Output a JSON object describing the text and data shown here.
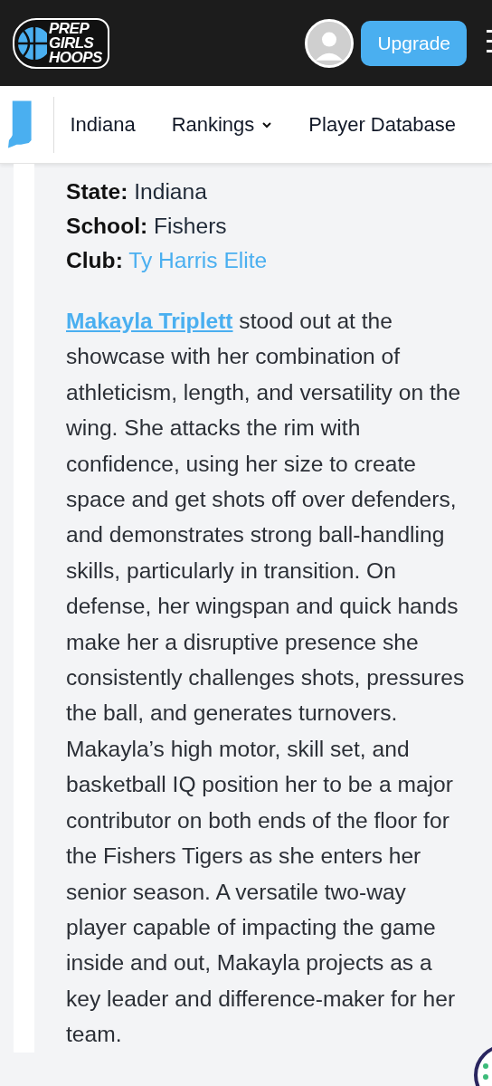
{
  "header": {
    "logo": {
      "lines": [
        "PREP",
        "GIRLS",
        "HOOPS"
      ]
    },
    "upgrade_button": "Upgrade"
  },
  "nav": {
    "items": [
      {
        "label": "Indiana",
        "kind": "link"
      },
      {
        "label": "Rankings",
        "kind": "dropdown"
      },
      {
        "label": "Player Database",
        "kind": "link"
      }
    ]
  },
  "details": [
    {
      "label": "State:",
      "value": "Indiana",
      "kind": "text"
    },
    {
      "label": "School:",
      "value": "Fishers",
      "kind": "text"
    },
    {
      "label": "Club:",
      "value": "Ty Harris Elite",
      "kind": "link"
    }
  ],
  "paragraph": {
    "link": "Makayla Triplett",
    "text": " stood out at the showcase with her combination of athleticism, length, and versatility on the wing. She attacks the rim with confidence, using her size to create space and get shots off over defenders, and demonstrates strong ball-handling skills, particularly in transition. On defense, her wingspan and quick hands make her a disruptive presence she consistently challenges shots, pressures the ball, and generates turnovers. Makayla’s high motor, skill set, and basketball IQ position her to be a major contributor on both ends of the floor for the Fishers Tigers as she enters her senior season. A versatile two-way player capable of impacting the game inside and out, Makayla projects as a key leader and difference-maker for her team."
  }
}
